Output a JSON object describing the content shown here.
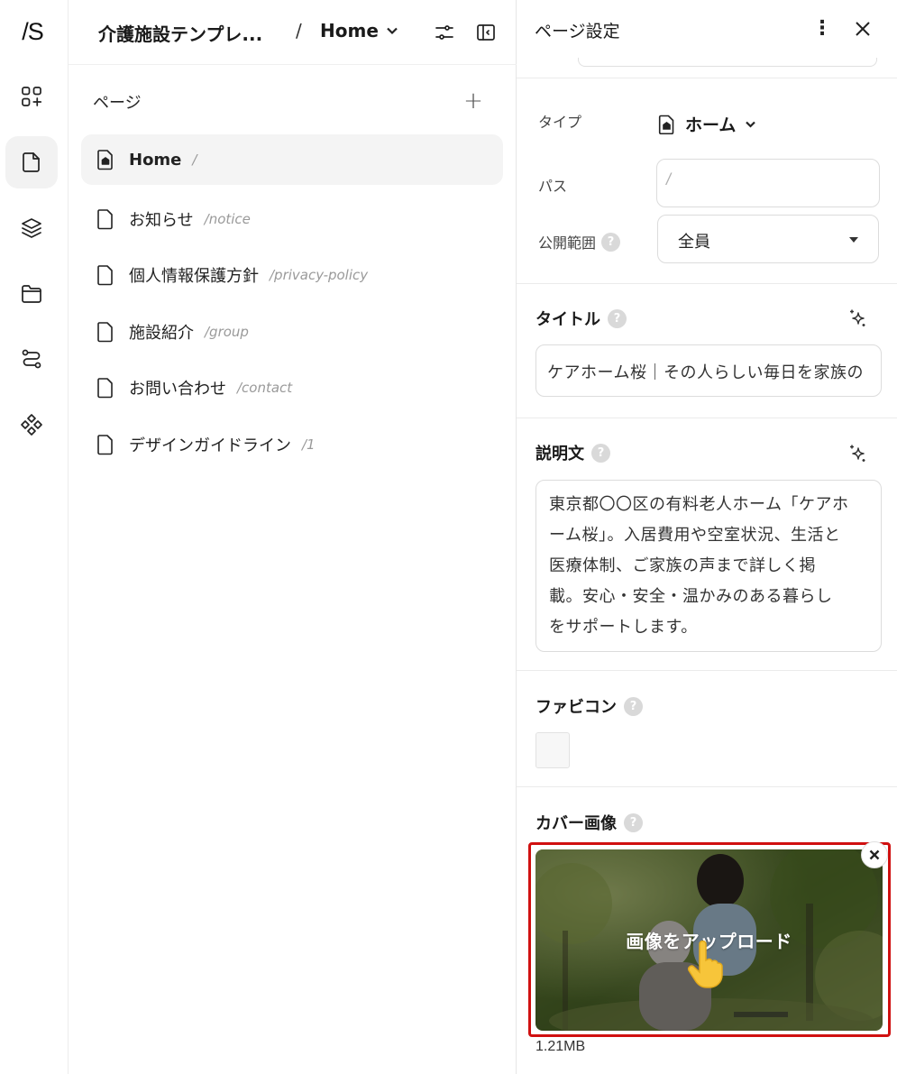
{
  "header": {
    "site_name": "介護施設テンプレ...",
    "separator": "/",
    "current_page": "Home"
  },
  "pages_panel": {
    "heading": "ページ",
    "add_label": "+",
    "items": [
      {
        "name": "Home",
        "path": "/",
        "icon": "home-page-icon",
        "active": true
      },
      {
        "name": "お知らせ",
        "path": "/notice",
        "icon": "page-icon"
      },
      {
        "name": "個人情報保護方針",
        "path": "/privacy-policy",
        "icon": "page-icon"
      },
      {
        "name": "施設紹介",
        "path": "/group",
        "icon": "page-icon"
      },
      {
        "name": "お問い合わせ",
        "path": "/contact",
        "icon": "page-icon"
      },
      {
        "name": "デザインガイドライン",
        "path": "/1",
        "icon": "page-icon"
      }
    ]
  },
  "rail": {
    "logo": "/S",
    "icons": [
      "add-section-icon",
      "pages-icon",
      "layers-icon",
      "folder-icon",
      "workflow-icon",
      "components-icon"
    ],
    "active": "pages-icon"
  },
  "settings": {
    "title": "ページ設定",
    "more_label": "⋮",
    "type": {
      "label": "タイプ",
      "value": "ホーム"
    },
    "path": {
      "label": "パス",
      "placeholder": "/"
    },
    "visibility": {
      "label": "公開範囲",
      "value": "全員"
    },
    "help_mark": "?",
    "page_title": {
      "label": "タイトル",
      "value": "ケアホーム桜｜その人らしい毎日を家族の"
    },
    "description": {
      "label": "説明文",
      "value": "東京都〇〇区の有料老人ホーム「ケアホ\nーム桜」。入居費用や空室状況、生活と\n医療体制、ご家族の声まで詳しく掲\n載。安心・安全・温かみのある暮らし\nをサポートします。"
    },
    "favicon": {
      "label": "ファビコン"
    },
    "cover": {
      "label": "カバー画像",
      "upload_label": "画像をアップロード",
      "file_size": "1.21MB",
      "highlight_color": "#d01010"
    }
  }
}
